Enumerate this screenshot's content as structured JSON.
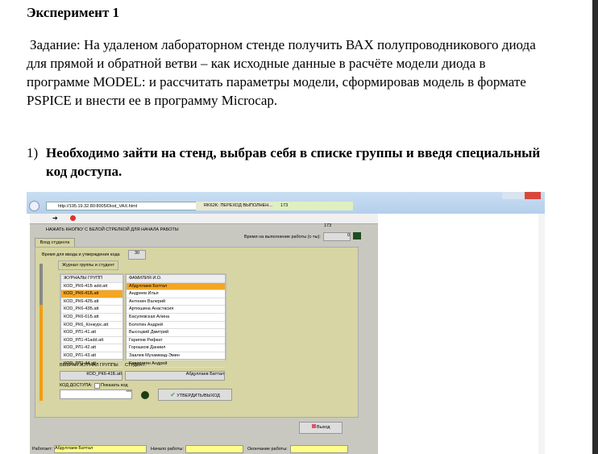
{
  "title": "Эксперимент 1",
  "task": "Задание: На удаленом лабораторном стенде получить ВАХ полупроводникового диода для прямой и обратной ветви – как исходные данные в расчёте модели диода в программе MODEL: и рассчитать параметры модели, сформировав модель в формате PSPICE и внести ее в программу Microcap.",
  "step": {
    "number": "1)",
    "text": "Необходимо зайти на стенд, выбрав себя в списке группы и введя специальный код доступа."
  },
  "screenshot": {
    "url": "http://195.19.32.80:8005/Diod_VAX.html",
    "tab1": "RK62K: ПЕРЕХОД ВЫПОЛНЕН...",
    "tab2": "173",
    "instruction": "НАЖАТЬ КНОПКУ С БЕЛОЙ СТРЕЛКОЙ ДЛЯ НАЧАЛА РАБОТЫ",
    "counter": "173",
    "time_label": "Время на выполнение работы (с-ты):",
    "time_value": "0",
    "tab_login": "Вход студента",
    "code_time_label": "Время для ввода и утверждения кода",
    "code_time_value": "30",
    "subtab": "Журнал группы и студент",
    "groups_header": "ЖУРНАЛЫ ГРУПП",
    "groups": [
      "КОD_РК6-41Б add.att",
      "КОD_РК6-41Б.att",
      "КОD_РК6-42Б.att",
      "КОD_РК6-43Б.att",
      "КОD_РК6-61Б.att",
      "КОD_РК6_Конкурс.att",
      "КОD_РЛ1-41.att",
      "КОD_РЛ1-41add.att",
      "КОD_РЛ1-42.att",
      "КОD_РЛ1-43.att",
      "КОD_РЛ1-44.att"
    ],
    "students_header": "ФАМИЛИЯ И.О.",
    "students": [
      "Абдуллаев Баттал",
      "Андреев Илья",
      "Антонин Валерий",
      "Артюшина Анастасия",
      "Басулевская Алина",
      "Болотин Андрей",
      "Высоцкий Дмитрий",
      "Гарипов Рифкат",
      "Горошков Даниил",
      "Заалев Мухаммад-Эмин",
      "Карапетян Андрей"
    ],
    "selected_group_label": "ВЫБРАН ЖУРНАЛ ГРУППЫ",
    "selected_group": "КОD_РК6-41Б.att",
    "student_label": "СТУДЕНТ:",
    "student": "Абдуллаев Баттал",
    "access_code_label": "КОД ДОСТУПА:",
    "show_code_label": "Показать код",
    "access_code": "***",
    "confirm_button": "УТВЕРДИТЬ/ВЫХОД",
    "exit_button": "Выход",
    "working_label": "Работает:",
    "working_value": "Абдуллаев Баттал",
    "start_label": "Начало работы:",
    "end_label": "Окончание работы:"
  }
}
